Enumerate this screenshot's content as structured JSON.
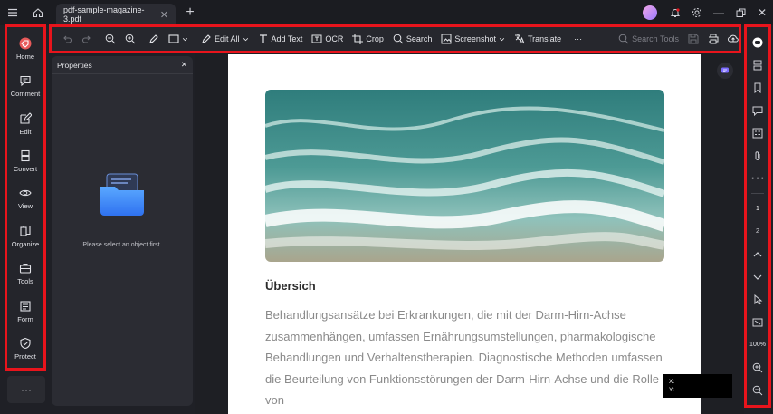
{
  "titlebar": {
    "tab_title": "pdf-sample-magazine-3.pdf"
  },
  "leftbar": {
    "items": [
      {
        "label": "Home",
        "icon": "home-rocket-icon"
      },
      {
        "label": "Comment",
        "icon": "comment-icon"
      },
      {
        "label": "Edit",
        "icon": "edit-icon"
      },
      {
        "label": "Convert",
        "icon": "convert-icon"
      },
      {
        "label": "View",
        "icon": "view-icon"
      },
      {
        "label": "Organize",
        "icon": "organize-icon"
      },
      {
        "label": "Tools",
        "icon": "tools-icon"
      },
      {
        "label": "Form",
        "icon": "form-icon"
      },
      {
        "label": "Protect",
        "icon": "protect-icon"
      }
    ],
    "more": "···"
  },
  "toolbar": {
    "edit_all": "Edit All",
    "add_text": "Add Text",
    "ocr": "OCR",
    "crop": "Crop",
    "search": "Search",
    "screenshot": "Screenshot",
    "translate": "Translate",
    "more": "···",
    "search_tools_placeholder": "Search Tools"
  },
  "properties": {
    "title": "Properties",
    "message": "Please select an object first."
  },
  "document": {
    "heading": "Übersich",
    "paragraph": "Behandlungsansätze bei Erkrankungen, die mit der Darm-Hirn-Achse zusammenhängen, umfassen Ernährungsumstellungen, pharmakologische Behandlungen und Verhaltenstherapien. Diagnostische Methoden umfassen die Beurteilung von Funktionsstörungen der Darm-Hirn-Achse und die Rolle von"
  },
  "coords": {
    "x_label": "X:",
    "y_label": "Y:"
  },
  "rightbar": {
    "page_1": "1",
    "page_2": "2",
    "zoom": "100%"
  },
  "colors": {
    "highlight": "#e8141c",
    "accent": "#4d7cfe"
  }
}
